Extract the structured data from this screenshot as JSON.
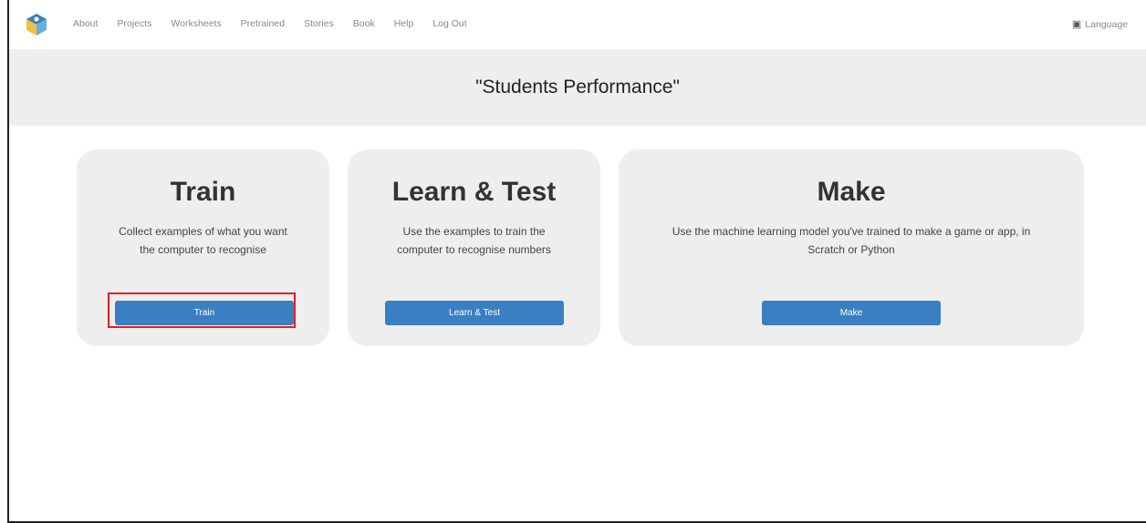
{
  "nav": {
    "links": [
      "About",
      "Projects",
      "Worksheets",
      "Pretrained",
      "Stories",
      "Book",
      "Help",
      "Log Out"
    ],
    "language": "Language"
  },
  "banner": {
    "title": "\"Students Performance\""
  },
  "cards": [
    {
      "heading": "Train",
      "desc_line1": "Collect examples of what you want",
      "desc_line2": "the computer to recognise",
      "button": "Train"
    },
    {
      "heading": "Learn & Test",
      "desc_line1": "Use the examples to train the",
      "desc_line2": "computer to recognise numbers",
      "button": "Learn & Test"
    },
    {
      "heading": "Make",
      "desc_line1": "Use the machine learning model you've trained to make a game or app, in",
      "desc_line2": "Scratch or Python",
      "button": "Make"
    }
  ],
  "colors": {
    "button": "#3a7fc1",
    "card_bg": "#eeeeee",
    "highlight": "#e02020"
  }
}
